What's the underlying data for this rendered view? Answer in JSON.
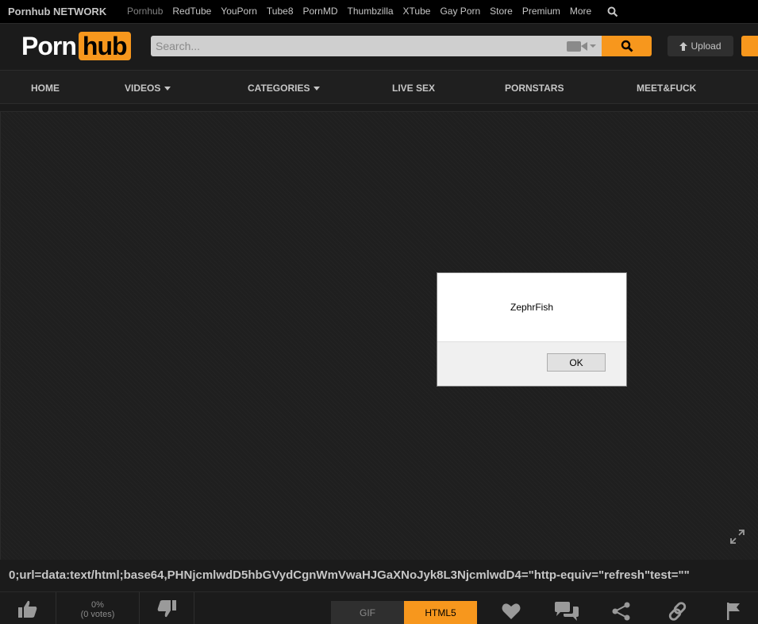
{
  "network": {
    "brand": "Pornhub NETWORK",
    "links": [
      "Pornhub",
      "RedTube",
      "YouPorn",
      "Tube8",
      "PornMD",
      "Thumbzilla",
      "XTube",
      "Gay Porn",
      "Store",
      "Premium",
      "More"
    ]
  },
  "header": {
    "logo_left": "Porn",
    "logo_right": "hub",
    "search_placeholder": "Search...",
    "upload_label": "Upload"
  },
  "nav": {
    "home": "HOME",
    "videos": "VIDEOS",
    "categories": "CATEGORIES",
    "live_sex": "LIVE SEX",
    "pornstars": "PORNSTARS",
    "meet": "MEET&FUCK"
  },
  "dialog": {
    "message": "ZephrFish",
    "ok_label": "OK"
  },
  "video": {
    "title": "0;url=data:text/html;base64,PHNjcmlwdD5hbGVydCgnWmVwaHJGaXNoJyk8L3NjcmlwdD4=\"http-equiv=\"refresh\"test=\"\""
  },
  "rating": {
    "percent": "0%",
    "votes": "(0 votes)"
  },
  "tabs": {
    "gif": "GIF",
    "html5": "HTML5"
  },
  "colors": {
    "accent": "#f7971d",
    "background": "#1b1b1b",
    "text": "#c6c6c6"
  }
}
